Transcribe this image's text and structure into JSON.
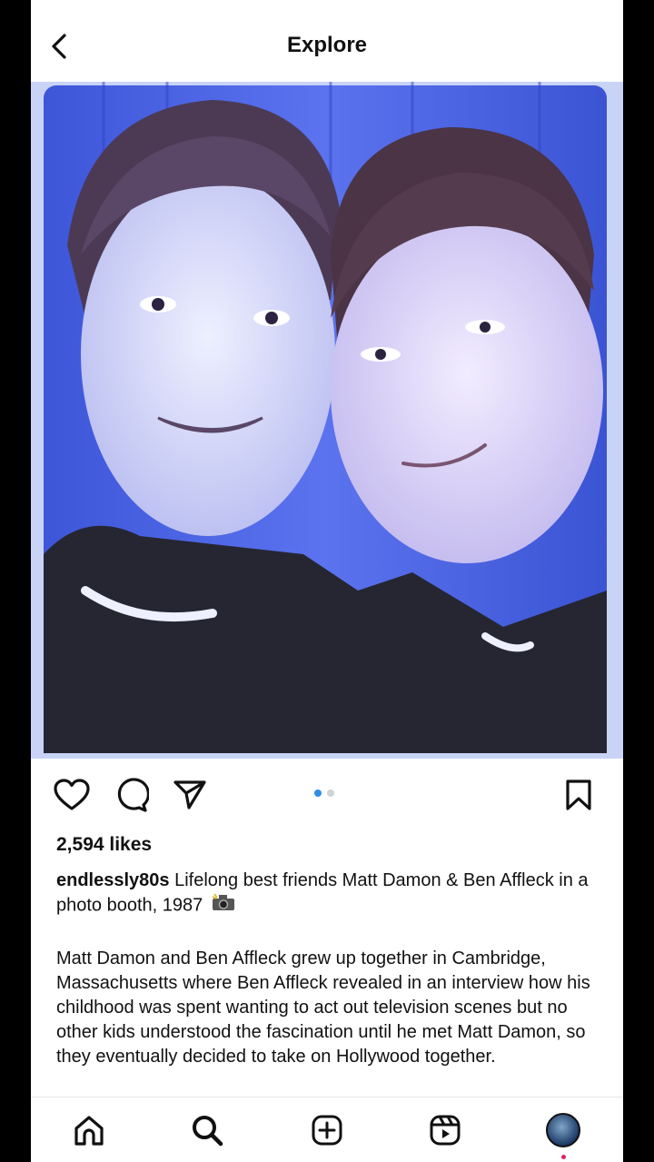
{
  "header": {
    "title": "Explore",
    "back_icon": "chevron-left-icon"
  },
  "post": {
    "likes": "2,594 likes",
    "username": "endlessly80s",
    "caption": "Lifelong best friends Matt Damon & Ben Affleck in a photo booth, 1987",
    "caption_emoji": "camera-with-flash-icon",
    "description": "Matt Damon and Ben Affleck grew up together in Cambridge, Massachusetts where Ben Affleck revealed in an interview how his childhood was spent wanting to act out television scenes but no other kids understood the fascination until he met Matt Damon, so they eventually decided to take on Hollywood together.",
    "carousel": {
      "total": 2,
      "active": 1
    }
  },
  "actions": [
    "heart-icon",
    "comment-icon",
    "share-icon",
    "bookmark-icon"
  ],
  "nav": [
    "home-icon",
    "search-icon",
    "create-icon",
    "reels-icon",
    "profile-avatar"
  ],
  "colors": {
    "accent": "#2f8de5",
    "photo_background": "#4c63e2",
    "text": "#111111"
  }
}
